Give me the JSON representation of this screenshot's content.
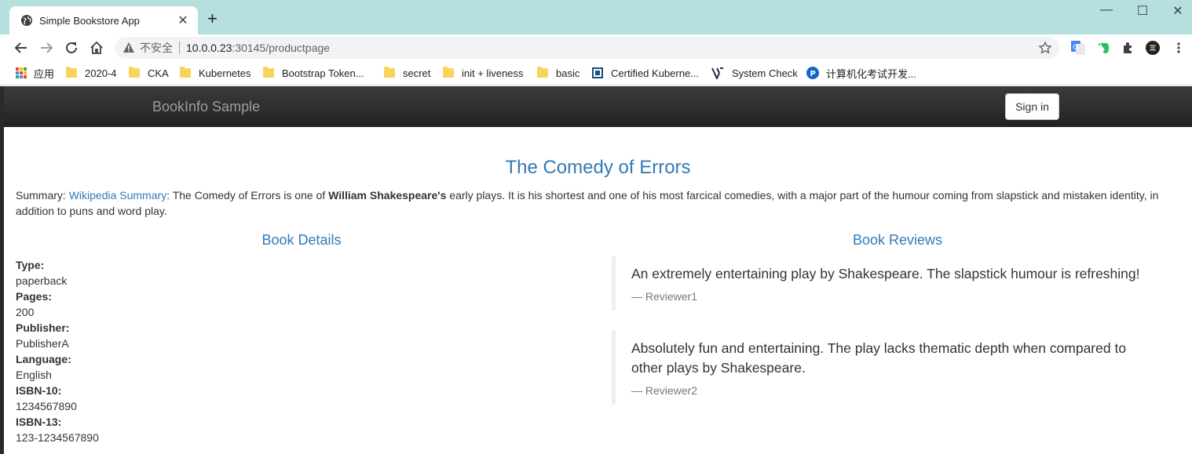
{
  "browser": {
    "tab_title": "Simple Bookstore App",
    "tab_close": "✕",
    "new_tab": "+",
    "window_controls": {
      "minimize": "—",
      "maximize": "☐",
      "close": "✕"
    },
    "address": {
      "insecure_label": "不安全",
      "host": "10.0.0.23",
      "rest": ":30145/productpage"
    },
    "bookmarks": [
      {
        "label": "应用",
        "kind": "apps"
      },
      {
        "label": "2020-4",
        "kind": "folder"
      },
      {
        "label": "CKA",
        "kind": "folder"
      },
      {
        "label": "Kubernetes",
        "kind": "folder"
      },
      {
        "label": "Bootstrap Token...",
        "kind": "folder"
      },
      {
        "label": "secret",
        "kind": "folder"
      },
      {
        "label": "init + liveness",
        "kind": "folder"
      },
      {
        "label": "basic",
        "kind": "folder"
      },
      {
        "label": "Certified Kuberne...",
        "kind": "site"
      },
      {
        "label": "System Check",
        "kind": "site"
      },
      {
        "label": "计算机化考试开发...",
        "kind": "site"
      }
    ]
  },
  "navbar": {
    "brand": "BookInfo Sample",
    "signin": "Sign in"
  },
  "book": {
    "title": "The Comedy of Errors",
    "summary_label": "Summary: ",
    "summary_link": "Wikipedia Summary",
    "summary_pre": ": The Comedy of Errors is one of ",
    "summary_bold": "William Shakespeare's",
    "summary_post": " early plays. It is his shortest and one of his most farcical comedies, with a major part of the humour coming from slapstick and mistaken identity, in addition to puns and word play."
  },
  "details": {
    "heading": "Book Details",
    "items": [
      {
        "label": "Type:",
        "value": "paperback"
      },
      {
        "label": "Pages:",
        "value": "200"
      },
      {
        "label": "Publisher:",
        "value": "PublisherA"
      },
      {
        "label": "Language:",
        "value": "English"
      },
      {
        "label": "ISBN-10:",
        "value": "1234567890"
      },
      {
        "label": "ISBN-13:",
        "value": "123-1234567890"
      }
    ]
  },
  "reviews": {
    "heading": "Book Reviews",
    "items": [
      {
        "text": "An extremely entertaining play by Shakespeare. The slapstick humour is refreshing!",
        "author": "— Reviewer1"
      },
      {
        "text": "Absolutely fun and entertaining. The play lacks thematic depth when compared to other plays by Shakespeare.",
        "author": "— Reviewer2"
      }
    ]
  }
}
